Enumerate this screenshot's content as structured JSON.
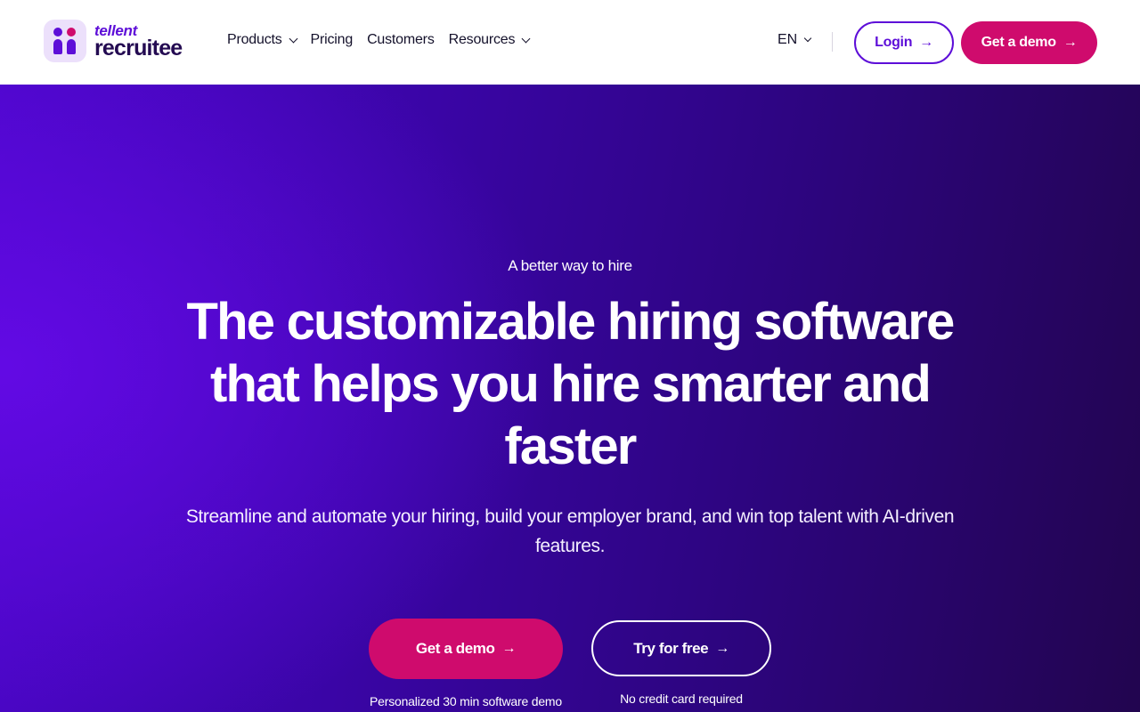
{
  "header": {
    "logo": {
      "top": "tellent",
      "bottom": "recruitee"
    },
    "nav": [
      {
        "label": "Products",
        "has_dropdown": true
      },
      {
        "label": "Pricing",
        "has_dropdown": false
      },
      {
        "label": "Customers",
        "has_dropdown": false
      },
      {
        "label": "Resources",
        "has_dropdown": true
      }
    ],
    "language": "EN",
    "login_label": "Login",
    "demo_label": "Get a demo"
  },
  "hero": {
    "eyebrow": "A better way to hire",
    "headline": "The customizable hiring software that helps you hire smarter and faster",
    "subheadline": "Streamline and automate your hiring, build your employer brand, and win top talent with AI-driven features.",
    "cta_primary": "Get a demo",
    "cta_primary_note": "Personalized 30 min software demo",
    "cta_secondary": "Try for free",
    "cta_secondary_note": "No credit card required"
  },
  "colors": {
    "brand_purple": "#5d0ed8",
    "brand_magenta": "#cf0b6d",
    "dark_navy": "#240b52"
  },
  "icons": {
    "arrow": "→",
    "chevron": "chevron-down-icon"
  }
}
